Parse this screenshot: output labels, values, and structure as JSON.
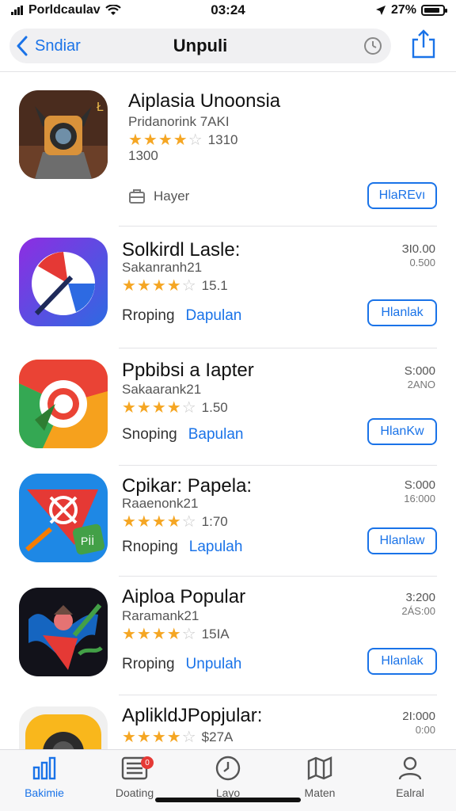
{
  "status": {
    "carrier": "Porldcaulav",
    "time": "03:24",
    "battery": "27%"
  },
  "nav": {
    "back_label": "Sndiar",
    "title": "Unpuli"
  },
  "apps": [
    {
      "title": "Aiplasia Unoonsia",
      "subtitle": "Pridanorink 7AKI",
      "rating": 4.5,
      "rating_text": "1310",
      "extra": "1300",
      "hauler_label": "Hayer",
      "button": "HlaREvı"
    },
    {
      "title": "Solkirdl Lasle:",
      "subtitle": "Sakanranh21",
      "rating": 4.5,
      "rating_text": "15.1",
      "category": "Rroping",
      "category_link": "Dapulan",
      "price_top": "ЗІ0.00",
      "price_bottom": "0.500",
      "button": "Hlanlak"
    },
    {
      "title": "Ppbibsi a Iapter",
      "subtitle": "Sakaarank21",
      "rating": 4.5,
      "rating_text": "1.50",
      "category": "Snoping",
      "category_link": "Bapulan",
      "price_top": "S:000",
      "price_bottom": "2ANO",
      "button": "HlanKw"
    },
    {
      "title": "Cpikar: Papela:",
      "subtitle": "Raaenonk21",
      "rating": 4.5,
      "rating_text": "1:70",
      "category": "Rnoping",
      "category_link": "Lapulah",
      "price_top": "S:000",
      "price_bottom": "16:000",
      "button": "Hlanlaw"
    },
    {
      "title": "Aiploa Popular",
      "subtitle": "Raramank21",
      "rating": 4.5,
      "rating_text": "15IA",
      "category": "Rroping",
      "category_link": "Unpulah",
      "price_top": "3:200",
      "price_bottom": "2ÁS:00",
      "button": "Hlanlak"
    },
    {
      "title": "AplikldJPopjular:",
      "rating": 4.5,
      "rating_text": "$27A",
      "price_top": "2І:000",
      "price_bottom": "0:00"
    }
  ],
  "tabs": [
    {
      "label": "Bakimie",
      "icon": "chart-icon"
    },
    {
      "label": "Doating",
      "icon": "list-icon",
      "badge": "0"
    },
    {
      "label": "Layo",
      "icon": "clock-icon"
    },
    {
      "label": "Maten",
      "icon": "map-icon"
    },
    {
      "label": "Ealral",
      "icon": "person-icon"
    }
  ],
  "colors": {
    "accent": "#1a73e8",
    "star": "#f5a623",
    "badge": "#e53935"
  }
}
